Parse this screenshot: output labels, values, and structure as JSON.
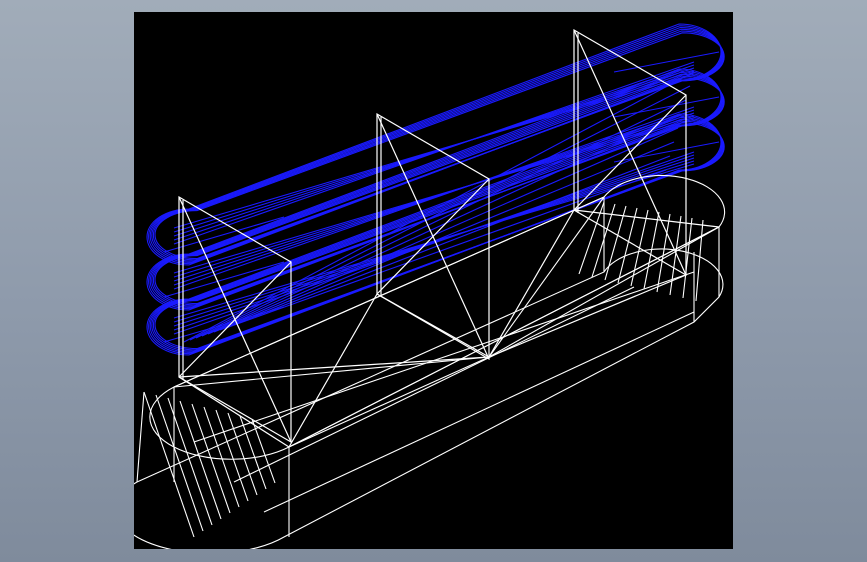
{
  "viewport": {
    "background": "#000000",
    "page_background": "#8e9aab"
  },
  "model": {
    "render_mode": "wireframe",
    "colors": {
      "base_solid": "#ffffff",
      "spring_coils": "#1a1aff"
    },
    "icon": "3d-wireframe-model"
  }
}
